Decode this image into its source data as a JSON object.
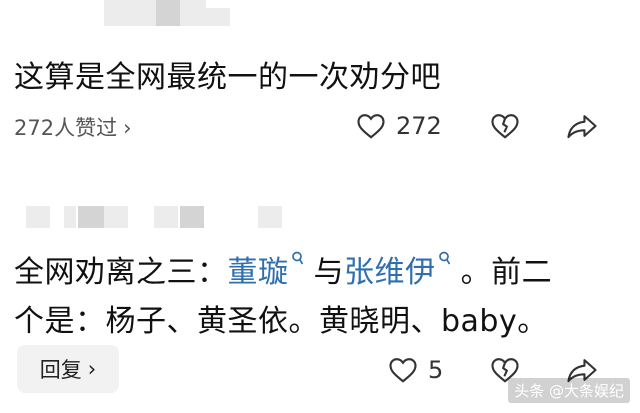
{
  "comment_1": {
    "text": "这算是全网最统一的一次劝分吧",
    "likes_link": "272人赞过",
    "like_count": "272"
  },
  "comment_2": {
    "text_prefix": "全网劝离之三：",
    "mention_1": "董璇",
    "text_mid": " 与",
    "mention_2": "张维伊",
    "text_suffix": " 。前二",
    "line_2": "个是：杨子、黄圣依。黄晓明、baby。",
    "reply_label": "回复",
    "like_count": "5"
  },
  "watermark": "头条 @大条娱纪",
  "icons": {
    "chevron": "chevron-right-icon",
    "like": "heart-outline-icon",
    "dislike": "broken-heart-icon",
    "share": "share-arrow-icon",
    "search": "search-icon"
  }
}
